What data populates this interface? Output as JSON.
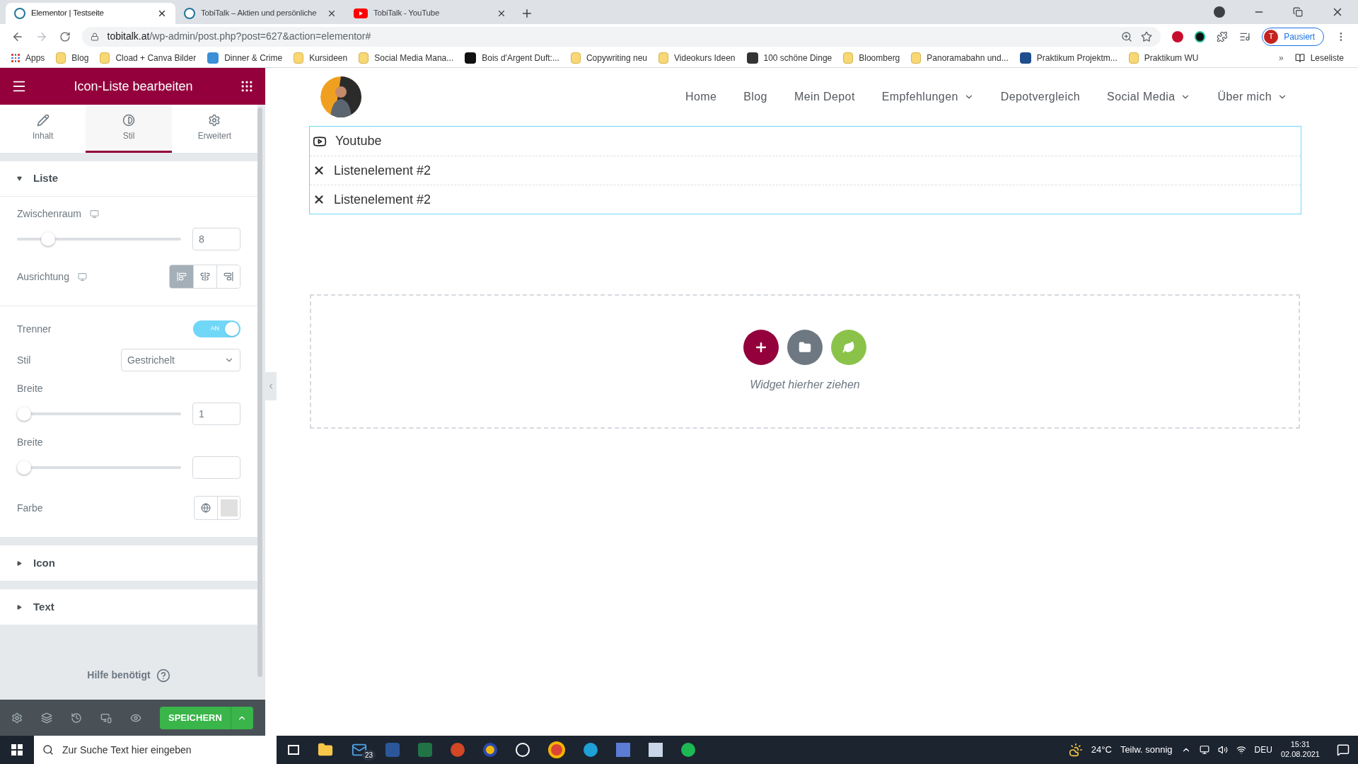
{
  "browser": {
    "tabs": [
      {
        "title": "Elementor | Testseite",
        "selected": true
      },
      {
        "title": "TobiTalk – Aktien und persönliche",
        "selected": false
      },
      {
        "title": "TobiTalk - YouTube",
        "selected": false
      }
    ],
    "url": {
      "host": "tobitalk.at",
      "path": "/wp-admin/post.php?post=627&action=elementor#"
    },
    "profile": {
      "initial": "T",
      "label": "Pausiert"
    },
    "bookmarks": [
      {
        "label": "Apps",
        "kind": "apps"
      },
      {
        "label": "Blog",
        "kind": "folder"
      },
      {
        "label": "Cload + Canva Bilder",
        "kind": "folder"
      },
      {
        "label": "Dinner & Crime",
        "kind": "site",
        "color": "#3b8fd6"
      },
      {
        "label": "Kursideen",
        "kind": "folder"
      },
      {
        "label": "Social Media Mana...",
        "kind": "folder"
      },
      {
        "label": "Bois d'Argent Duft:...",
        "kind": "site",
        "color": "#111111"
      },
      {
        "label": "Copywriting neu",
        "kind": "folder"
      },
      {
        "label": "Videokurs Ideen",
        "kind": "folder"
      },
      {
        "label": "100 schöne Dinge",
        "kind": "site",
        "color": "#333333"
      },
      {
        "label": "Bloomberg",
        "kind": "folder"
      },
      {
        "label": "Panoramabahn und...",
        "kind": "folder"
      },
      {
        "label": "Praktikum Projektm...",
        "kind": "site",
        "color": "#1f4e8c"
      },
      {
        "label": "Praktikum WU",
        "kind": "folder"
      }
    ],
    "more_bookmarks": "»",
    "reading_list": "Leseliste"
  },
  "editor": {
    "title": "Icon-Liste bearbeiten",
    "tabs": [
      {
        "label": "Inhalt",
        "selected": false
      },
      {
        "label": "Stil",
        "selected": true
      },
      {
        "label": "Erweitert",
        "selected": false
      }
    ],
    "sections": [
      {
        "title": "Liste",
        "expanded": true,
        "controls": [
          {
            "kind": "slider",
            "label": "Zwischenraum",
            "responsive": true,
            "level": 0.16,
            "value": "8"
          },
          {
            "kind": "align",
            "label": "Ausrichtung",
            "responsive": true,
            "options": [
              {
                "selected": true
              },
              {
                "selected": false
              },
              {
                "selected": false
              }
            ]
          },
          {
            "kind": "toggle",
            "label": "Trenner",
            "on": true,
            "text": "AN"
          },
          {
            "kind": "select",
            "label": "Stil",
            "value": "Gestrichelt"
          },
          {
            "kind": "slider",
            "label": "Breite",
            "level": 0,
            "value": "1"
          },
          {
            "kind": "slider",
            "label": "Breite",
            "level": 0
          },
          {
            "kind": "color",
            "label": "Farbe"
          }
        ]
      },
      {
        "title": "Icon",
        "expanded": false
      },
      {
        "title": "Text",
        "expanded": false
      }
    ],
    "help": "Hilfe benötigt",
    "save": "SPEICHERN"
  },
  "page": {
    "nav": [
      {
        "label": "Home",
        "dropdown": false
      },
      {
        "label": "Blog",
        "dropdown": false
      },
      {
        "label": "Mein Depot",
        "dropdown": false
      },
      {
        "label": "Empfehlungen",
        "dropdown": true
      },
      {
        "label": "Depotvergleich",
        "dropdown": false
      },
      {
        "label": "Social Media",
        "dropdown": true
      },
      {
        "label": "Über mich",
        "dropdown": true
      }
    ],
    "list": [
      {
        "kind": "video",
        "text": "Youtube"
      },
      {
        "kind": "cross",
        "text": "Listenelement #2"
      },
      {
        "kind": "cross",
        "text": "Listenelement #2"
      }
    ],
    "dropzone": "Widget hierher ziehen"
  },
  "taskbar": {
    "search": "Zur Suche Text hier eingeben",
    "mail_badge": "23",
    "temperature": "24°C",
    "weather": "Teilw. sonnig",
    "language": "DEU",
    "time": "15:31",
    "date": "02.08.2021"
  }
}
